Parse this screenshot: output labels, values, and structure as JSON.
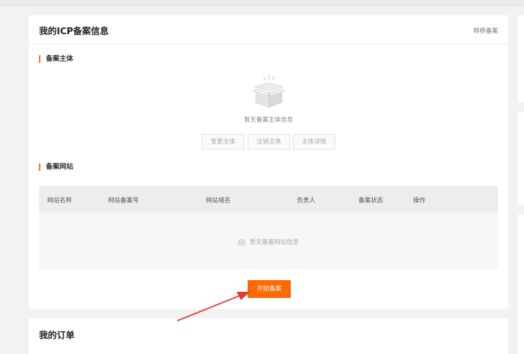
{
  "icp": {
    "title": "我的ICP备案信息",
    "transfer_link": "转移备案",
    "subject_section": "备案主体",
    "empty_subject": "暂无备案主体信息",
    "buttons": [
      "变更主体",
      "注销主体",
      "主体详情"
    ],
    "website_section": "备案网站",
    "table": {
      "columns": [
        "网站名称",
        "网站备案号",
        "网站域名",
        "负责人",
        "备案状态",
        "操作"
      ],
      "empty_text": "暂无备案网站信息"
    },
    "start_button": "开始备案"
  },
  "orders": {
    "title": "我的订单"
  },
  "colors": {
    "accent": "#ff6a00",
    "annotation_arrow": "#e53935"
  },
  "icons": [
    "empty-box-icon",
    "empty-tray-icon",
    "annotation-arrow"
  ]
}
